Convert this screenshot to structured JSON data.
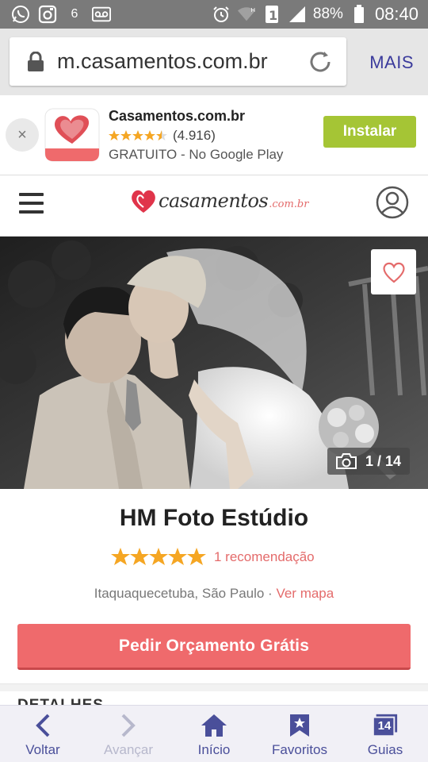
{
  "status_bar": {
    "network_label": "6",
    "sim_label": "1",
    "battery": "88%",
    "time": "08:40"
  },
  "browser": {
    "url": "m.casamentos.com.br",
    "more_label": "MAIS"
  },
  "app_banner": {
    "close_label": "×",
    "title": "Casamentos.com.br",
    "rating": "(4.916)",
    "stars_fraction": 0.9,
    "subtitle": "GRATUITO - No Google Play",
    "install_label": "Instalar"
  },
  "header": {
    "logo_text": "casamentos",
    "logo_suffix": ".com.br"
  },
  "gallery": {
    "counter": "1 / 14"
  },
  "vendor": {
    "name": "HM Foto Estúdio",
    "stars": 5,
    "recommendations": "1 recomendação",
    "location": "Itaquaquecetuba, São Paulo · ",
    "map_link": "Ver mapa"
  },
  "cta": {
    "label": "Pedir Orçamento Grátis"
  },
  "section": {
    "details_label": "DETALHES"
  },
  "bottom_nav": {
    "back": "Voltar",
    "forward": "Avançar",
    "home": "Início",
    "favorites": "Favoritos",
    "guides": "Guias",
    "guides_badge": "14"
  },
  "colors": {
    "accent": "#ef6a6c",
    "nav": "#4a4f9a",
    "install": "#a5c535",
    "star": "#f5a623"
  }
}
